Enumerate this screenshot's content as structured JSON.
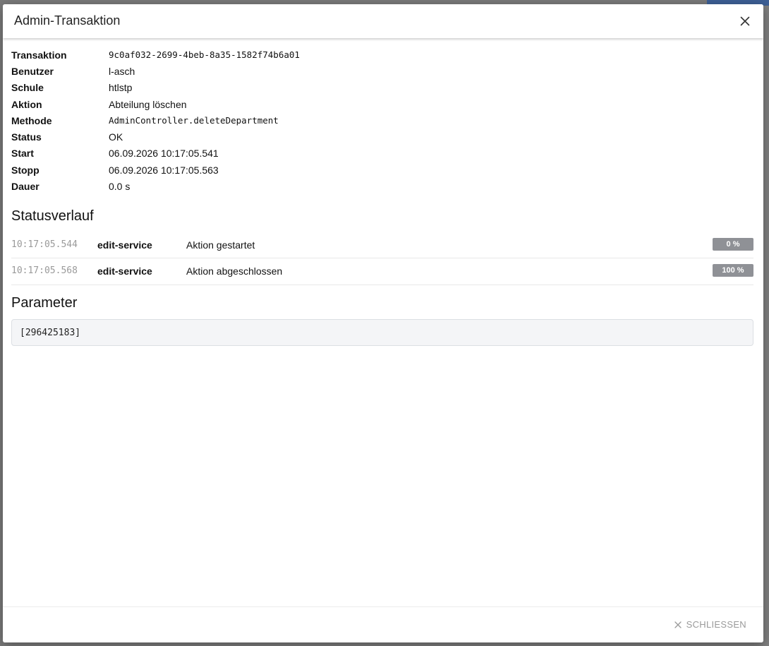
{
  "dialog": {
    "title": "Admin-Transaktion",
    "close_icon": "close-icon"
  },
  "details": [
    {
      "label": "Transaktion",
      "value": "9c0af032-2699-4beb-8a35-1582f74b6a01",
      "mono": true
    },
    {
      "label": "Benutzer",
      "value": "l-asch",
      "mono": false
    },
    {
      "label": "Schule",
      "value": "htlstp",
      "mono": false
    },
    {
      "label": "Aktion",
      "value": "Abteilung löschen",
      "mono": false
    },
    {
      "label": "Methode",
      "value": "AdminController.deleteDepartment",
      "mono": true
    },
    {
      "label": "Status",
      "value": "OK",
      "mono": false
    },
    {
      "label": "Start",
      "value": "06.09.2026 10:17:05.541",
      "mono": false
    },
    {
      "label": "Stopp",
      "value": "06.09.2026 10:17:05.563",
      "mono": false
    },
    {
      "label": "Dauer",
      "value": "0.0 s",
      "mono": false
    }
  ],
  "status_history": {
    "heading": "Statusverlauf",
    "entries": [
      {
        "time": "10:17:05.544",
        "service": "edit-service",
        "message": "Aktion gestartet",
        "progress": "0 %"
      },
      {
        "time": "10:17:05.568",
        "service": "edit-service",
        "message": "Aktion abgeschlossen",
        "progress": "100 %"
      }
    ]
  },
  "parameters": {
    "heading": "Parameter",
    "value": "[296425183]"
  },
  "footer": {
    "close_label": "SCHLIESSEN",
    "close_icon": "close-icon"
  },
  "colors": {
    "badge": "#8f9196",
    "muted_text": "#9a9a9a",
    "param_bg": "#f4f5f7"
  }
}
